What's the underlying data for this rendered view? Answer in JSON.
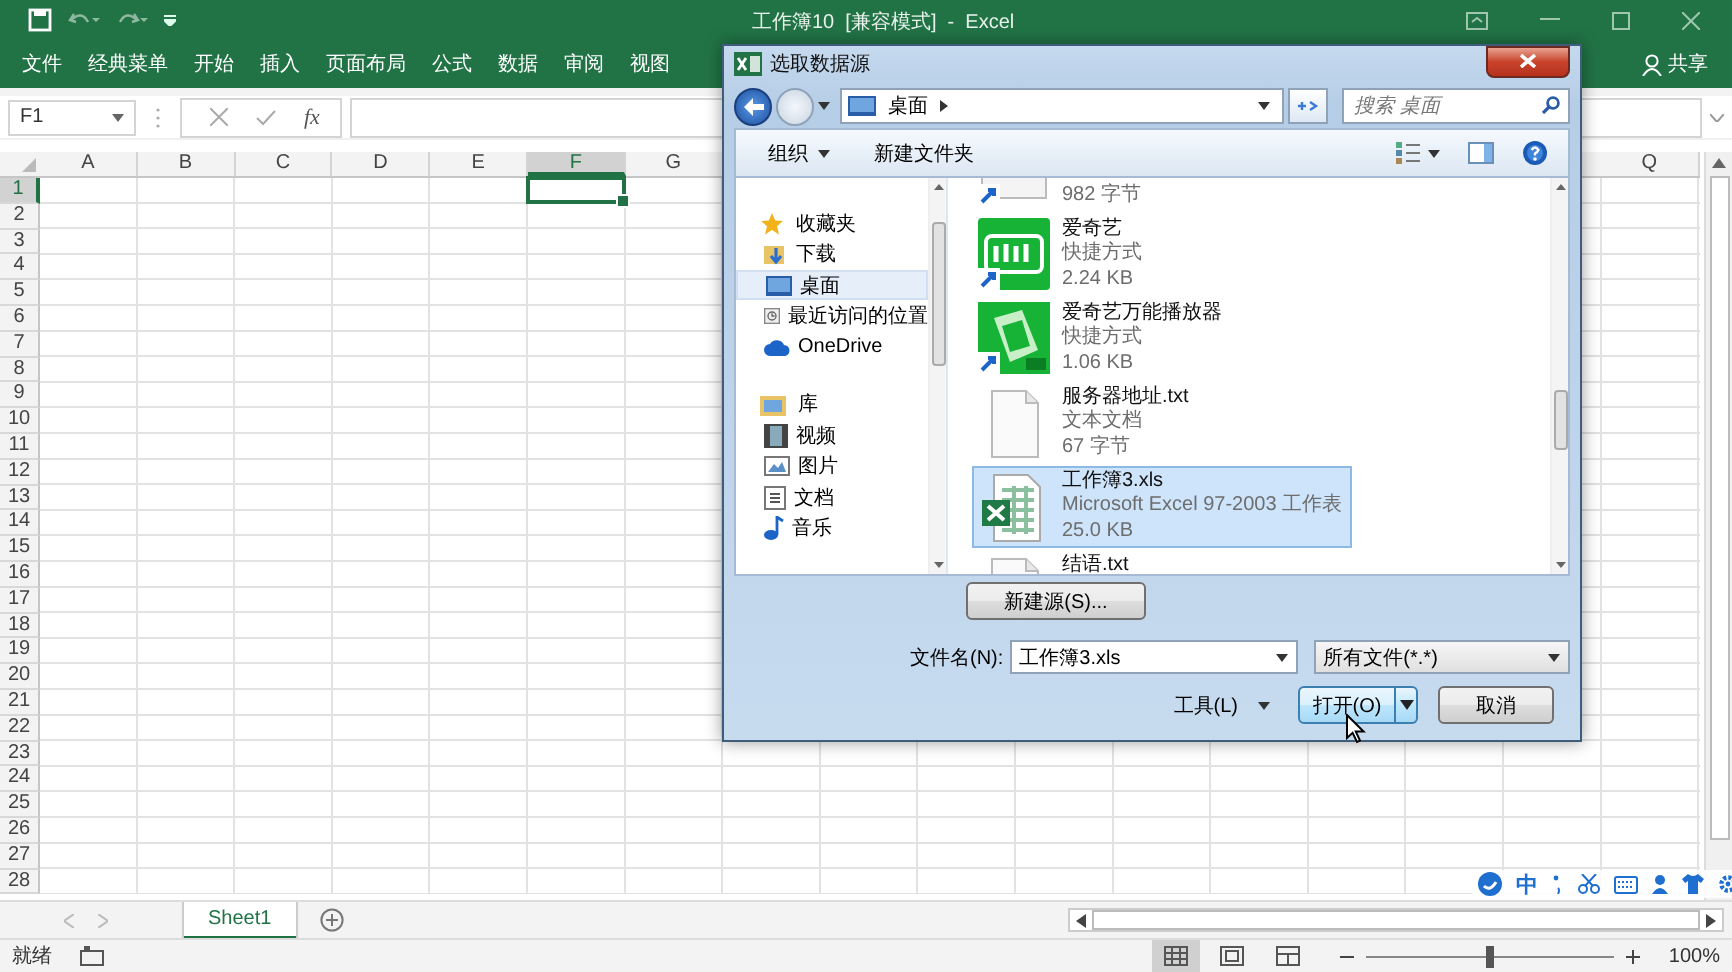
{
  "excel": {
    "title": "工作簿10  [兼容模式]  -  Excel",
    "ribbon_tabs": [
      {
        "label": "文件"
      },
      {
        "label": "经典菜单"
      },
      {
        "label": "开始"
      },
      {
        "label": "插入"
      },
      {
        "label": "页面布局"
      },
      {
        "label": "公式"
      },
      {
        "label": "数据"
      },
      {
        "label": "审阅"
      },
      {
        "label": "视图"
      }
    ],
    "share": "共享",
    "name_box": "F1",
    "fx": "fx",
    "columns": [
      {
        "label": "A",
        "selected": false
      },
      {
        "label": "B",
        "selected": false
      },
      {
        "label": "C",
        "selected": false
      },
      {
        "label": "D",
        "selected": false
      },
      {
        "label": "E",
        "selected": false
      },
      {
        "label": "F",
        "selected": true
      },
      {
        "label": "G",
        "selected": false
      }
    ],
    "right_columns": [
      {
        "label": "Q",
        "selected": false
      }
    ],
    "rows": [
      {
        "label": "1",
        "selected": true
      },
      {
        "label": "2",
        "selected": false
      },
      {
        "label": "3",
        "selected": false
      },
      {
        "label": "4",
        "selected": false
      },
      {
        "label": "5",
        "selected": false
      },
      {
        "label": "6",
        "selected": false
      },
      {
        "label": "7",
        "selected": false
      },
      {
        "label": "8",
        "selected": false
      },
      {
        "label": "9",
        "selected": false
      },
      {
        "label": "10",
        "selected": false
      },
      {
        "label": "11",
        "selected": false
      },
      {
        "label": "12",
        "selected": false
      },
      {
        "label": "13",
        "selected": false
      },
      {
        "label": "14",
        "selected": false
      },
      {
        "label": "15",
        "selected": false
      },
      {
        "label": "16",
        "selected": false
      },
      {
        "label": "17",
        "selected": false
      },
      {
        "label": "18",
        "selected": false
      },
      {
        "label": "19",
        "selected": false
      },
      {
        "label": "20",
        "selected": false
      },
      {
        "label": "21",
        "selected": false
      },
      {
        "label": "22",
        "selected": false
      },
      {
        "label": "23",
        "selected": false
      },
      {
        "label": "24",
        "selected": false
      },
      {
        "label": "25",
        "selected": false
      },
      {
        "label": "26",
        "selected": false
      },
      {
        "label": "27",
        "selected": false
      },
      {
        "label": "28",
        "selected": false
      }
    ],
    "sheet_tabs": [
      {
        "label": "Sheet1",
        "selected": true
      }
    ],
    "status": "就绪",
    "zoom": {
      "level": 0.5,
      "reading": "100%"
    }
  },
  "ime_bar": {
    "label": "中"
  },
  "dialog": {
    "title": "选取数据源",
    "address": "桌面",
    "search": {
      "placeholder": "搜索 桌面"
    },
    "toolbar": [
      {
        "label": "组织",
        "dropdown": true
      },
      {
        "label": "新建文件夹",
        "dropdown": false
      }
    ],
    "nav": [
      {
        "label": "收藏夹",
        "kind": "star",
        "selected": false,
        "children": [
          {
            "label": "下载",
            "kind": "download",
            "selected": false
          },
          {
            "label": "桌面",
            "kind": "desktop",
            "selected": true
          },
          {
            "label": "最近访问的位置",
            "kind": "recent",
            "selected": false
          },
          {
            "label": "OneDrive",
            "kind": "cloud",
            "selected": false
          }
        ]
      },
      {
        "label": "库",
        "kind": "library",
        "selected": false,
        "children": [
          {
            "label": "视频",
            "kind": "video",
            "selected": false
          },
          {
            "label": "图片",
            "kind": "picture",
            "selected": false
          },
          {
            "label": "文档",
            "kind": "document",
            "selected": false
          },
          {
            "label": "音乐",
            "kind": "music",
            "selected": false
          }
        ]
      }
    ],
    "files": [
      {
        "size": "982 字节",
        "kind": "generic",
        "shortcut": true,
        "selected": false
      },
      {
        "name": "爱奇艺",
        "type": "快捷方式",
        "size": "2.24 KB",
        "kind": "iqiyi",
        "shortcut": true,
        "selected": false
      },
      {
        "name": "爱奇艺万能播放器",
        "type": "快捷方式",
        "size": "1.06 KB",
        "kind": "player",
        "shortcut": true,
        "selected": false
      },
      {
        "name": "服务器地址.txt",
        "type": "文本文档",
        "size": "67 字节",
        "kind": "text",
        "shortcut": false,
        "selected": false
      },
      {
        "name": "工作簿3.xls",
        "type": "Microsoft Excel 97-2003 工作表",
        "size": "25.0 KB",
        "kind": "excel",
        "shortcut": false,
        "selected": true
      },
      {
        "name": "结语.txt",
        "kind": "text",
        "shortcut": false,
        "selected": false
      }
    ],
    "new_source_button": "新建源(S)...",
    "filename_label": "文件名(N):",
    "filename": "工作簿3.xls",
    "filter": "所有文件(*.*)",
    "tools": "工具(L)",
    "open_button": "打开(O)",
    "cancel_button": "取消"
  }
}
